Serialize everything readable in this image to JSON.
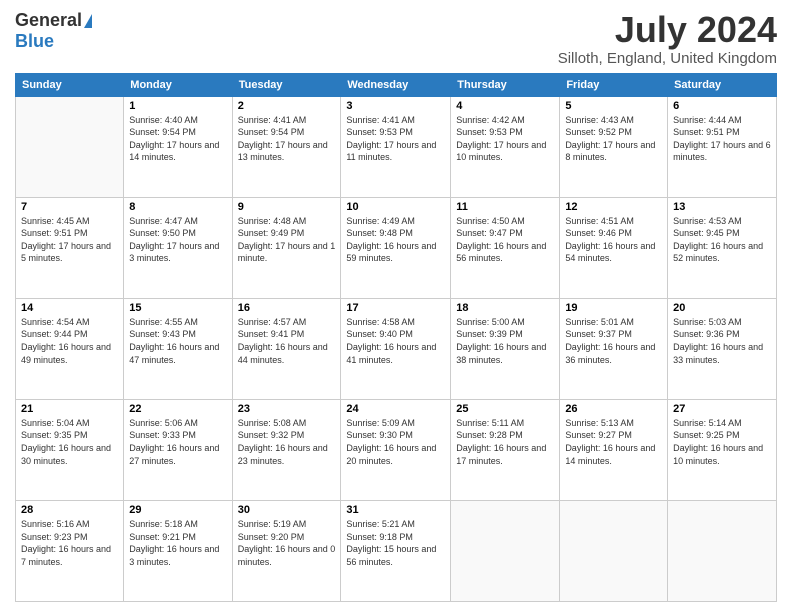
{
  "logo": {
    "general": "General",
    "blue": "Blue"
  },
  "title": "July 2024",
  "location": "Silloth, England, United Kingdom",
  "days_of_week": [
    "Sunday",
    "Monday",
    "Tuesday",
    "Wednesday",
    "Thursday",
    "Friday",
    "Saturday"
  ],
  "weeks": [
    [
      {
        "day": "",
        "sunrise": "",
        "sunset": "",
        "daylight": ""
      },
      {
        "day": "1",
        "sunrise": "Sunrise: 4:40 AM",
        "sunset": "Sunset: 9:54 PM",
        "daylight": "Daylight: 17 hours and 14 minutes."
      },
      {
        "day": "2",
        "sunrise": "Sunrise: 4:41 AM",
        "sunset": "Sunset: 9:54 PM",
        "daylight": "Daylight: 17 hours and 13 minutes."
      },
      {
        "day": "3",
        "sunrise": "Sunrise: 4:41 AM",
        "sunset": "Sunset: 9:53 PM",
        "daylight": "Daylight: 17 hours and 11 minutes."
      },
      {
        "day": "4",
        "sunrise": "Sunrise: 4:42 AM",
        "sunset": "Sunset: 9:53 PM",
        "daylight": "Daylight: 17 hours and 10 minutes."
      },
      {
        "day": "5",
        "sunrise": "Sunrise: 4:43 AM",
        "sunset": "Sunset: 9:52 PM",
        "daylight": "Daylight: 17 hours and 8 minutes."
      },
      {
        "day": "6",
        "sunrise": "Sunrise: 4:44 AM",
        "sunset": "Sunset: 9:51 PM",
        "daylight": "Daylight: 17 hours and 6 minutes."
      }
    ],
    [
      {
        "day": "7",
        "sunrise": "Sunrise: 4:45 AM",
        "sunset": "Sunset: 9:51 PM",
        "daylight": "Daylight: 17 hours and 5 minutes."
      },
      {
        "day": "8",
        "sunrise": "Sunrise: 4:47 AM",
        "sunset": "Sunset: 9:50 PM",
        "daylight": "Daylight: 17 hours and 3 minutes."
      },
      {
        "day": "9",
        "sunrise": "Sunrise: 4:48 AM",
        "sunset": "Sunset: 9:49 PM",
        "daylight": "Daylight: 17 hours and 1 minute."
      },
      {
        "day": "10",
        "sunrise": "Sunrise: 4:49 AM",
        "sunset": "Sunset: 9:48 PM",
        "daylight": "Daylight: 16 hours and 59 minutes."
      },
      {
        "day": "11",
        "sunrise": "Sunrise: 4:50 AM",
        "sunset": "Sunset: 9:47 PM",
        "daylight": "Daylight: 16 hours and 56 minutes."
      },
      {
        "day": "12",
        "sunrise": "Sunrise: 4:51 AM",
        "sunset": "Sunset: 9:46 PM",
        "daylight": "Daylight: 16 hours and 54 minutes."
      },
      {
        "day": "13",
        "sunrise": "Sunrise: 4:53 AM",
        "sunset": "Sunset: 9:45 PM",
        "daylight": "Daylight: 16 hours and 52 minutes."
      }
    ],
    [
      {
        "day": "14",
        "sunrise": "Sunrise: 4:54 AM",
        "sunset": "Sunset: 9:44 PM",
        "daylight": "Daylight: 16 hours and 49 minutes."
      },
      {
        "day": "15",
        "sunrise": "Sunrise: 4:55 AM",
        "sunset": "Sunset: 9:43 PM",
        "daylight": "Daylight: 16 hours and 47 minutes."
      },
      {
        "day": "16",
        "sunrise": "Sunrise: 4:57 AM",
        "sunset": "Sunset: 9:41 PM",
        "daylight": "Daylight: 16 hours and 44 minutes."
      },
      {
        "day": "17",
        "sunrise": "Sunrise: 4:58 AM",
        "sunset": "Sunset: 9:40 PM",
        "daylight": "Daylight: 16 hours and 41 minutes."
      },
      {
        "day": "18",
        "sunrise": "Sunrise: 5:00 AM",
        "sunset": "Sunset: 9:39 PM",
        "daylight": "Daylight: 16 hours and 38 minutes."
      },
      {
        "day": "19",
        "sunrise": "Sunrise: 5:01 AM",
        "sunset": "Sunset: 9:37 PM",
        "daylight": "Daylight: 16 hours and 36 minutes."
      },
      {
        "day": "20",
        "sunrise": "Sunrise: 5:03 AM",
        "sunset": "Sunset: 9:36 PM",
        "daylight": "Daylight: 16 hours and 33 minutes."
      }
    ],
    [
      {
        "day": "21",
        "sunrise": "Sunrise: 5:04 AM",
        "sunset": "Sunset: 9:35 PM",
        "daylight": "Daylight: 16 hours and 30 minutes."
      },
      {
        "day": "22",
        "sunrise": "Sunrise: 5:06 AM",
        "sunset": "Sunset: 9:33 PM",
        "daylight": "Daylight: 16 hours and 27 minutes."
      },
      {
        "day": "23",
        "sunrise": "Sunrise: 5:08 AM",
        "sunset": "Sunset: 9:32 PM",
        "daylight": "Daylight: 16 hours and 23 minutes."
      },
      {
        "day": "24",
        "sunrise": "Sunrise: 5:09 AM",
        "sunset": "Sunset: 9:30 PM",
        "daylight": "Daylight: 16 hours and 20 minutes."
      },
      {
        "day": "25",
        "sunrise": "Sunrise: 5:11 AM",
        "sunset": "Sunset: 9:28 PM",
        "daylight": "Daylight: 16 hours and 17 minutes."
      },
      {
        "day": "26",
        "sunrise": "Sunrise: 5:13 AM",
        "sunset": "Sunset: 9:27 PM",
        "daylight": "Daylight: 16 hours and 14 minutes."
      },
      {
        "day": "27",
        "sunrise": "Sunrise: 5:14 AM",
        "sunset": "Sunset: 9:25 PM",
        "daylight": "Daylight: 16 hours and 10 minutes."
      }
    ],
    [
      {
        "day": "28",
        "sunrise": "Sunrise: 5:16 AM",
        "sunset": "Sunset: 9:23 PM",
        "daylight": "Daylight: 16 hours and 7 minutes."
      },
      {
        "day": "29",
        "sunrise": "Sunrise: 5:18 AM",
        "sunset": "Sunset: 9:21 PM",
        "daylight": "Daylight: 16 hours and 3 minutes."
      },
      {
        "day": "30",
        "sunrise": "Sunrise: 5:19 AM",
        "sunset": "Sunset: 9:20 PM",
        "daylight": "Daylight: 16 hours and 0 minutes."
      },
      {
        "day": "31",
        "sunrise": "Sunrise: 5:21 AM",
        "sunset": "Sunset: 9:18 PM",
        "daylight": "Daylight: 15 hours and 56 minutes."
      },
      {
        "day": "",
        "sunrise": "",
        "sunset": "",
        "daylight": ""
      },
      {
        "day": "",
        "sunrise": "",
        "sunset": "",
        "daylight": ""
      },
      {
        "day": "",
        "sunrise": "",
        "sunset": "",
        "daylight": ""
      }
    ]
  ]
}
